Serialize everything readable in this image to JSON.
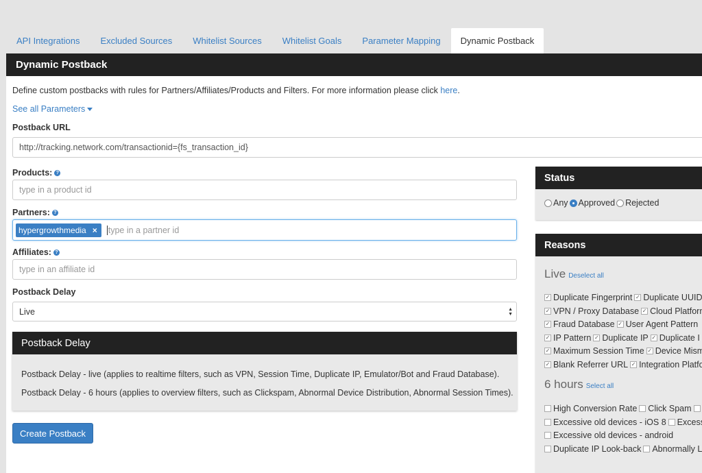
{
  "tabs": [
    {
      "label": "API Integrations"
    },
    {
      "label": "Excluded Sources"
    },
    {
      "label": "Whitelist Sources"
    },
    {
      "label": "Whitelist Goals"
    },
    {
      "label": "Parameter Mapping"
    },
    {
      "label": "Dynamic Postback"
    }
  ],
  "panel": {
    "title": "Dynamic Postback",
    "description": "Define custom postbacks with rules for Partners/Affiliates/Products and Filters. For more information please click ",
    "description_link": "here",
    "description_end": ".",
    "see_all": "See all Parameters"
  },
  "form": {
    "postback_url_label": "Postback URL",
    "postback_url_value": "http://tracking.network.com/transactionid={fs_transaction_id}",
    "products_label": "Products:",
    "products_placeholder": "type in a product id",
    "partners_label": "Partners:",
    "partner_tag": "hypergrowthmedia",
    "partners_placeholder": "type in a partner id",
    "affiliates_label": "Affiliates:",
    "affiliates_placeholder": "type in an affiliate id",
    "delay_label": "Postback Delay",
    "delay_value": "Live"
  },
  "delay_box": {
    "title": "Postback Delay",
    "line1": "Postback Delay - live (applies to realtime filters, such as VPN, Session Time, Duplicate IP, Emulator/Bot and Fraud Database).",
    "line2": "Postback Delay - 6 hours (applies to overview filters, such as Clickspam, Abnormal Device Distribution, Abnormal Session Times)."
  },
  "create_button": "Create Postback",
  "status": {
    "title": "Status",
    "options": [
      "Any",
      "Approved",
      "Rejected"
    ],
    "selected": "Approved"
  },
  "reasons": {
    "title": "Reasons",
    "live": {
      "title": "Live",
      "toggle": "Deselect all",
      "rows": [
        [
          "Duplicate Fingerprint",
          "Duplicate UUID"
        ],
        [
          "VPN / Proxy Database",
          "Cloud Platform"
        ],
        [
          "Fraud Database",
          "User Agent Pattern"
        ],
        [
          "IP Pattern",
          "Duplicate IP",
          "Duplicate I"
        ],
        [
          "Maximum Session Time",
          "Device Mism"
        ],
        [
          "Blank Referrer URL",
          "Integration Platfo"
        ]
      ]
    },
    "six_hours": {
      "title": "6 hours",
      "toggle": "Select all",
      "rows": [
        [
          "High Conversion Rate",
          "Click Spam",
          ""
        ],
        [
          "Excessive old devices - iOS 8",
          "Excessiv"
        ],
        [
          "Excessive old devices - android"
        ],
        [
          "Duplicate IP Look-back",
          "Abnormally L"
        ]
      ]
    }
  }
}
